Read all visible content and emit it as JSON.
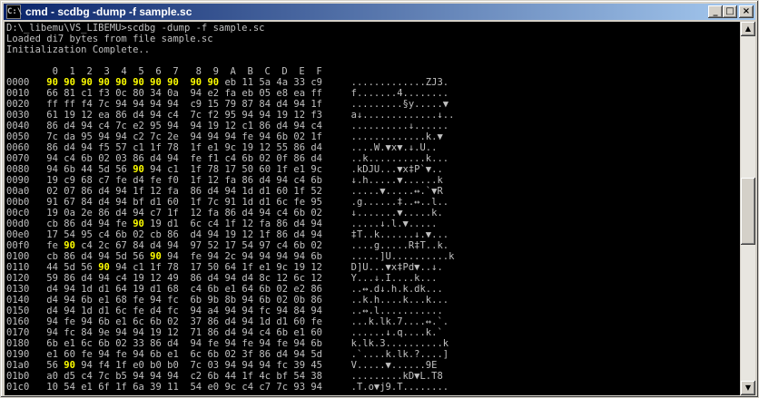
{
  "window": {
    "title": "cmd - scdbg -dump -f sample.sc",
    "app_icon": "C:\\",
    "buttons": {
      "minimize": "_",
      "maximize": "□",
      "close": "×"
    }
  },
  "console": {
    "lines": [
      "D:\\_libemu\\VS_LIBEMU>scdbg -dump -f sample.sc",
      "Loaded di7 bytes from file sample.sc",
      "Initialization Complete..",
      "",
      "        0  1  2  3  4  5  6  7   8  9  A  B  C  D  E  F",
      "0000   90 90 90 90 90 90 90 90  90 90 eb 11 5a 4a 33 c9     .............ZJ3.",
      "0010   66 81 c1 f3 0c 80 34 0a  94 e2 fa eb 05 e8 ea ff     f.......4........",
      "0020   ff ff f4 7c 94 94 94 94  c9 15 79 87 84 d4 94 1f     .........§y.....▼",
      "0030   61 19 12 ea 86 d4 94 c4  7c f2 95 94 94 19 12 f3     a↓.............↓..",
      "0040   86 d4 94 c4 7c e2 95 94  94 19 12 c1 86 d4 94 c4     ..........↓......",
      "0050   7c da 95 94 94 c2 7c 2e  94 94 94 fe 94 6b 02 1f     .............k.▼",
      "0060   86 d4 94 f5 57 c1 1f 78  1f e1 9c 19 12 55 86 d4     ....W.▼x▼.↓.U..",
      "0070   94 c4 6b 02 03 86 d4 94  fe f1 c4 6b 02 0f 86 d4     ..k..........k...",
      "0080   94 6b 44 5d 56 90 94 c1  1f 78 17 50 60 1f e1 9c     .kDJU...▼x‡P`▼..",
      "0090   19 c9 68 c7 fe d4 fe f0  1f 12 fa 86 d4 94 c4 6b     ↓.h.....▼......k",
      "00a0   02 07 86 d4 94 1f 12 fa  86 d4 94 1d d1 60 1f 52     .....▼.....↔.`▼R",
      "00b0   91 67 84 d4 94 bf d1 60  1f 7c 91 1d d1 6c fe 95     .g......‡..↔..l..",
      "00c0   19 0a 2e 86 d4 94 c7 1f  12 fa 86 d4 94 c4 6b 02     ↓.......▼.....k.",
      "00d0   cb 86 d4 94 fe 90 19 d1  6c c4 1f 12 fa 86 d4 94     .....↓.l.▼.....",
      "00e0   17 54 95 c4 6b 02 cb 86  d4 94 19 12 1f 86 d4 94     ‡T..k......↓.▼...",
      "00f0   fe 90 c4 2c 67 84 d4 94  97 52 17 54 97 c4 6b 02     ....g.....R‡T..k.",
      "0100   cb 86 d4 94 5d 56 90 94  fe 94 2c 94 94 94 94 6b     .....]U..........k",
      "0110   44 5d 56 90 94 c1 1f 78  17 50 64 1f e1 9c 19 12     D]U...▼x‡Pd▼..↓.",
      "0120   59 86 d4 94 c4 19 12 49  86 d4 94 d4 8c 12 6c 12     Y...↓.I....k...",
      "0130   d4 94 1d d1 64 19 d1 68  c4 6b e1 64 6b 02 e2 86     ..↔.d↓.h.k.dk...",
      "0140   d4 94 6b e1 68 fe 94 fc  6b 9b 8b 94 6b 02 0b 86     ..k.h....k...k...",
      "0150   d4 94 1d d1 6c fe d4 fc  94 a4 94 94 fc 94 84 94     ..↔.l...........",
      "0160   94 fe 94 6b e1 6c 6b 02  37 86 d4 94 1d d1 60 fe     ...k.lk.7....↔.`.",
      "0170   94 fc 84 9e 94 94 19 12  71 86 d4 94 c4 6b e1 60     ......↓.q....k.`",
      "0180   6b e1 6c 6b 02 33 86 d4  94 fe 94 fe 94 fe 94 6b     k.lk.3..........k",
      "0190   e1 60 fe 94 fe 94 6b e1  6c 6b 02 3f 86 d4 94 5d     .`....k.lk.?....]",
      "01a0   56 90 94 f4 1f e0 b0 b0  7c 03 94 94 94 fc 39 45     V.....▼......9E",
      "01b0   a0 d5 c4 7c b5 94 94 94  c2 6b 44 1f 4c bf 54 38     .........kD▼L.T8",
      "01c0   10 54 e1 6f 1f 6a 39 11  54 e0 9c c4 c7 7c 93 94     .T.o▼j9.T........"
    ],
    "highlight_token": "90"
  },
  "scrollbar": {
    "up_icon": "▲",
    "down_icon": "▼"
  }
}
